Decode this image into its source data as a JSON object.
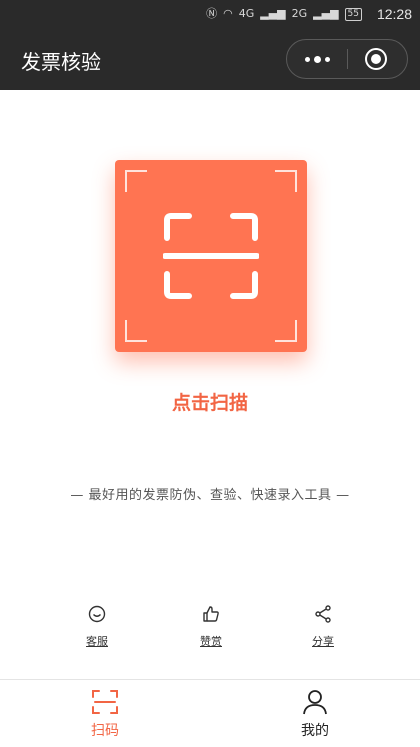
{
  "status_bar": {
    "network": "4G",
    "network2": "2G",
    "battery": "55",
    "time": "12:28"
  },
  "navbar": {
    "title": "发票核验"
  },
  "scan": {
    "label": "点击扫描",
    "accent_color": "#ff7452"
  },
  "tagline": "— 最好用的发票防伪、查验、快速录入工具 —",
  "actions": [
    {
      "label": "客服",
      "icon": "chat-icon"
    },
    {
      "label": "赞赏",
      "icon": "thumbs-up-icon"
    },
    {
      "label": "分享",
      "icon": "share-icon"
    }
  ],
  "tabbar": {
    "tabs": [
      {
        "label": "扫码",
        "icon": "scan-icon",
        "active": true
      },
      {
        "label": "我的",
        "icon": "user-icon",
        "active": false
      }
    ]
  }
}
